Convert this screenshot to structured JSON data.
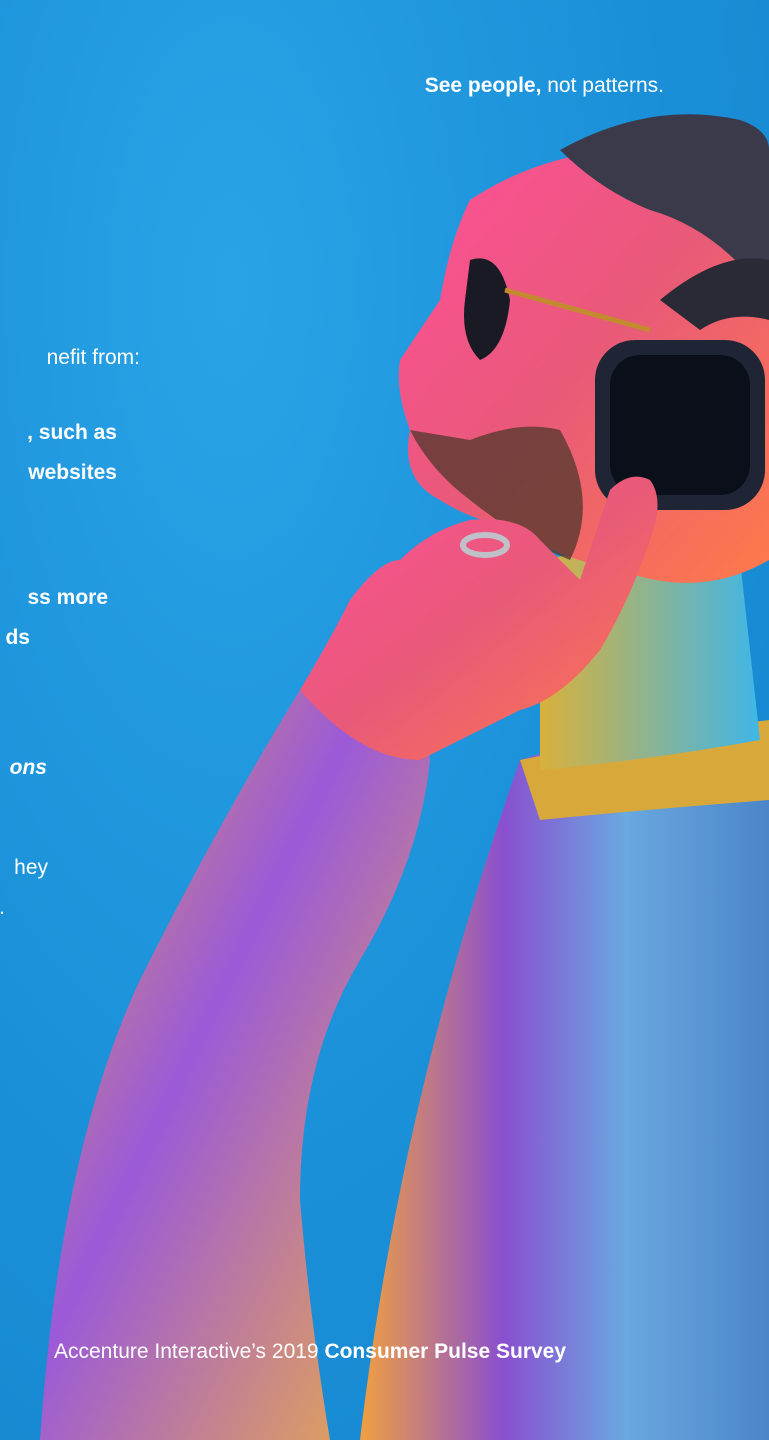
{
  "header": {
    "tagline_bold": "See people,",
    "tagline_rest": " not patterns."
  },
  "side_text": {
    "line1": "nefit from:",
    "line2": ", such as",
    "line3": "websites",
    "line4": "ss more",
    "line5": "ds",
    "line6": "ons",
    "line7": "hey",
    "line8": "."
  },
  "footer": {
    "prefix": "Accenture Interactive’s 2019 ",
    "survey": "Consumer Pulse Survey"
  },
  "colors": {
    "background": "#1a8fd6",
    "text": "#ffffff"
  }
}
